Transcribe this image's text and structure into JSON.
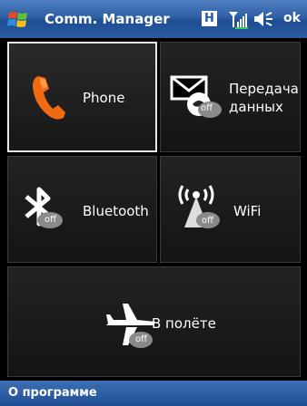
{
  "titlebar": {
    "title": "Comm. Manager",
    "start_icon": "windows-flag-icon",
    "h_indicator": "H",
    "ok_label": "ok"
  },
  "tiles": {
    "phone": {
      "label": "Phone",
      "icon": "phone-handset-icon",
      "selected": true
    },
    "data": {
      "label_line1": "Передача",
      "label_line2": "данных",
      "icon": "envelope-data-icon",
      "status": "off"
    },
    "bluetooth": {
      "label": "Bluetooth",
      "icon": "bluetooth-icon",
      "status": "off"
    },
    "wifi": {
      "label": "WiFi",
      "icon": "wifi-antenna-icon",
      "status": "off"
    },
    "flight": {
      "label": "В полёте",
      "icon": "airplane-icon",
      "status": "off"
    }
  },
  "bottombar": {
    "about_label": "О программе"
  },
  "colors": {
    "titlebar": "#2f5fa5",
    "phone_orange": "#f06a12",
    "tile_bg": "#1a1a1a"
  }
}
